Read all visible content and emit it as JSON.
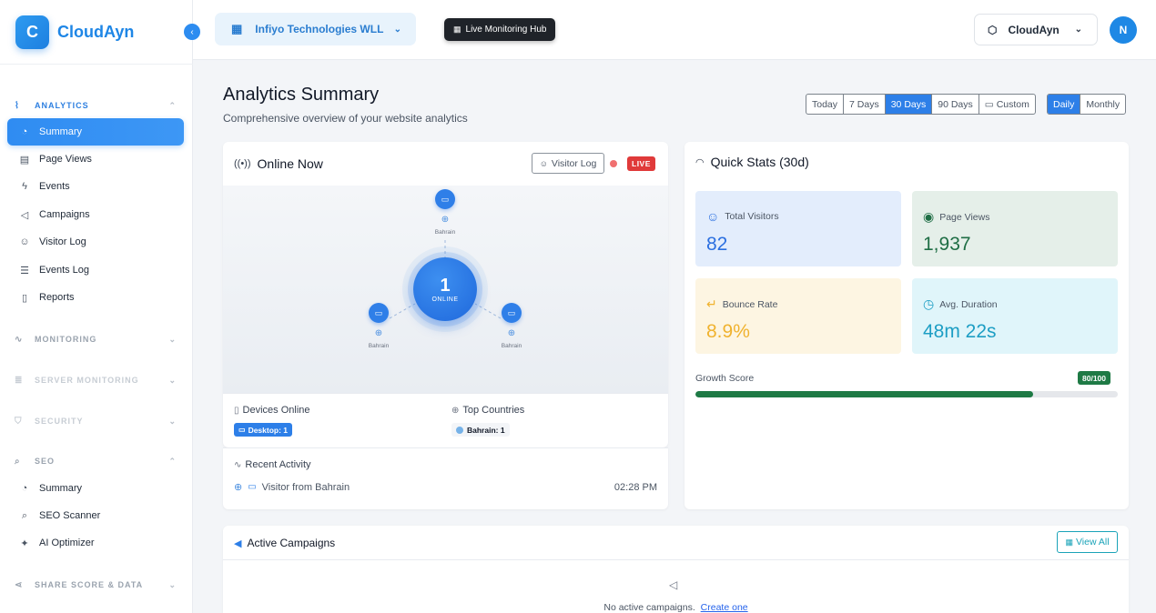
{
  "brand": {
    "logo_letter": "C",
    "name": "CloudAyn"
  },
  "topbar": {
    "org_name": "Infiyo Technologies WLL",
    "hub_label": "Live Monitoring Hub",
    "account_name": "CloudAyn",
    "avatar_initial": "N"
  },
  "sidebar": {
    "sections": [
      {
        "label": "ANALYTICS",
        "expanded": true,
        "locked": false
      },
      {
        "label": "MONITORING",
        "expanded": false,
        "locked": false
      },
      {
        "label": "SERVER MONITORING",
        "expanded": false,
        "locked": true
      },
      {
        "label": "SECURITY",
        "expanded": false,
        "locked": true
      },
      {
        "label": "SEO",
        "expanded": true,
        "locked": false
      },
      {
        "label": "SHARE SCORE & DATA",
        "expanded": false,
        "locked": false
      }
    ],
    "analytics_items": [
      {
        "label": "Summary",
        "icon": "dashboard-icon",
        "active": true
      },
      {
        "label": "Page Views",
        "icon": "file-icon",
        "active": false
      },
      {
        "label": "Events",
        "icon": "bolt-icon",
        "active": false
      },
      {
        "label": "Campaigns",
        "icon": "megaphone-icon",
        "active": false
      },
      {
        "label": "Visitor Log",
        "icon": "users-icon",
        "active": false
      },
      {
        "label": "Events Log",
        "icon": "list-icon",
        "active": false
      },
      {
        "label": "Reports",
        "icon": "report-icon",
        "active": false
      }
    ],
    "seo_items": [
      {
        "label": "Summary",
        "icon": "dashboard-icon"
      },
      {
        "label": "SEO Scanner",
        "icon": "search-icon"
      },
      {
        "label": "AI Optimizer",
        "icon": "sparkle-icon"
      }
    ]
  },
  "page": {
    "title": "Analytics Summary",
    "subtitle": "Comprehensive overview of your website analytics",
    "ranges": [
      "Today",
      "7 Days",
      "30 Days",
      "90 Days",
      "Custom"
    ],
    "selected_range": "30 Days",
    "granularity": [
      "Daily",
      "Monthly"
    ],
    "selected_granularity": "Daily"
  },
  "online": {
    "title": "Online Now",
    "visitor_log_label": "Visitor Log",
    "live_label": "LIVE",
    "count": "1",
    "count_label": "ONLINE",
    "nodes": [
      {
        "location": "Bahrain"
      },
      {
        "location": "Bahrain"
      },
      {
        "location": "Bahrain"
      }
    ],
    "devices_title": "Devices Online",
    "devices_chip": "Desktop: 1",
    "countries_title": "Top Countries",
    "countries_chip": "Bahrain: 1"
  },
  "recent": {
    "title": "Recent Activity",
    "items": [
      {
        "text": "Visitor from Bahrain",
        "time": "02:28 PM"
      }
    ]
  },
  "stats": {
    "title": "Quick Stats (30d)",
    "total_visitors_label": "Total Visitors",
    "total_visitors": "82",
    "page_views_label": "Page Views",
    "page_views": "1,937",
    "bounce_rate_label": "Bounce Rate",
    "bounce_rate": "8.9%",
    "avg_duration_label": "Avg. Duration",
    "avg_duration": "48m 22s",
    "growth_label": "Growth Score",
    "growth_badge": "80/100",
    "growth_value": 80,
    "growth_max": 100
  },
  "campaigns": {
    "title": "Active Campaigns",
    "view_all_label": "View All",
    "empty_text": "No active campaigns.",
    "create_link": "Create one"
  },
  "colors": {
    "accent": "#2d7fe8",
    "brand": "#1e86e6",
    "live": "#e03a3a",
    "growth": "#1e7a45",
    "view_all": "#1aa3b8"
  }
}
